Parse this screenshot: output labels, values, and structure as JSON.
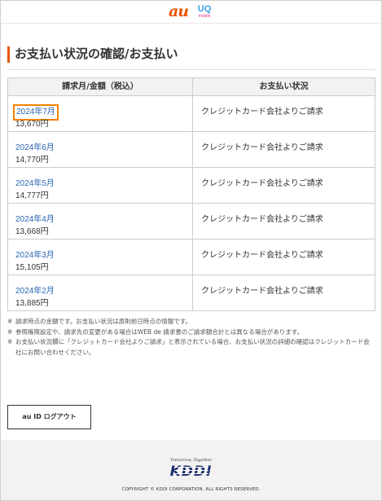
{
  "brand": {
    "au_logo": "au",
    "uq_logo": "UQ",
    "uq_sub": "mobile"
  },
  "page_title": "お支払い状況の確認/お支払い",
  "table": {
    "headers": [
      "請求月/金額（税込）",
      "お支払い状況"
    ],
    "rows": [
      {
        "month": "2024年7月",
        "amount": "13,670円",
        "status": "クレジットカード会社よりご請求",
        "selected": true
      },
      {
        "month": "2024年6月",
        "amount": "14,770円",
        "status": "クレジットカード会社よりご請求"
      },
      {
        "month": "2024年5月",
        "amount": "14,777円",
        "status": "クレジットカード会社よりご請求"
      },
      {
        "month": "2024年4月",
        "amount": "13,668円",
        "status": "クレジットカード会社よりご請求"
      },
      {
        "month": "2024年3月",
        "amount": "15,105円",
        "status": "クレジットカード会社よりご請求"
      },
      {
        "month": "2024年2月",
        "amount": "13,885円",
        "status": "クレジットカード会社よりご請求"
      }
    ]
  },
  "notes": [
    {
      "mark": "※",
      "text": "請求時点の金額です。お支払い状況は原則前日時点の情報です。"
    },
    {
      "mark": "※",
      "text": "参照権限設定や、請求先の変更がある場合はWEB de 請求書のご請求額合計とは異なる場合があります。"
    },
    {
      "mark": "※",
      "text": "お支払い状況欄に「クレジットカード会社よりご請求」と表示されている場合、お支払い状況の詳細の確認はクレジットカード会社にお問い合わせください。"
    }
  ],
  "logout_label": "au ID ログアウト",
  "footer": {
    "tagline": "Tomorrow, Together",
    "logo": "KDDI",
    "copyright": "COPYRIGHT © KDDI CORPORATION, ALL RIGHTS RESERVED."
  },
  "colors": {
    "accent": "#eb5505",
    "link": "#2a66b3",
    "highlight": "#f08300",
    "kddi_navy": "#1b2f6e"
  }
}
